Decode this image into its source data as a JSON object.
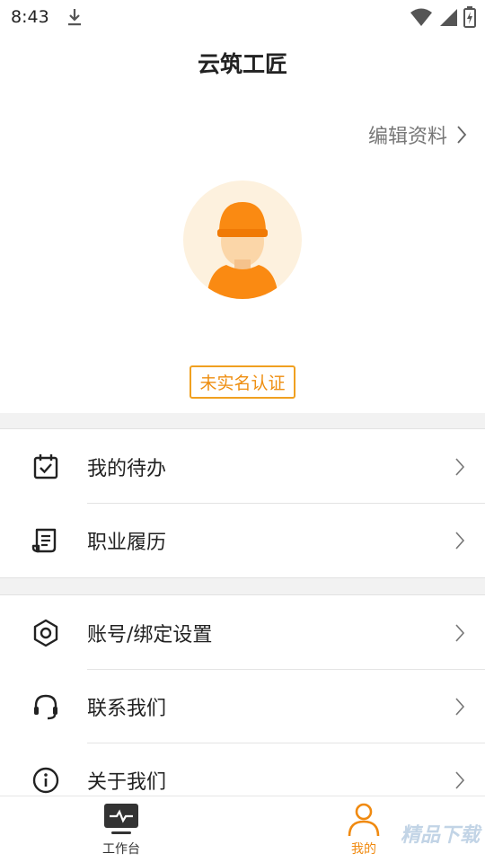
{
  "status_bar": {
    "time": "8:43",
    "icons": [
      "download-icon",
      "wifi-icon",
      "signal-icon",
      "battery-icon"
    ]
  },
  "header": {
    "title": "云筑工匠"
  },
  "profile": {
    "edit_label": "编辑资料",
    "verify_badge": "未实名认证"
  },
  "menu_group_1": [
    {
      "label": "我的待办",
      "icon": "calendar-check-icon"
    },
    {
      "label": "职业履历",
      "icon": "resume-icon"
    }
  ],
  "menu_group_2": [
    {
      "label": "账号/绑定设置",
      "icon": "hexagon-settings-icon"
    },
    {
      "label": "联系我们",
      "icon": "headset-icon"
    },
    {
      "label": "关于我们",
      "icon": "info-icon"
    }
  ],
  "tab_bar": {
    "tabs": [
      {
        "label": "工作台",
        "icon": "monitor-pulse-icon",
        "active": false
      },
      {
        "label": "我的",
        "icon": "user-icon",
        "active": true
      }
    ]
  },
  "colors": {
    "accent": "#f08a10",
    "badge_border": "#f0a020",
    "avatar_bg": "#fdf1de",
    "separator": "#e4e4e4",
    "band": "#f2f2f2"
  },
  "watermark": "精品下载"
}
